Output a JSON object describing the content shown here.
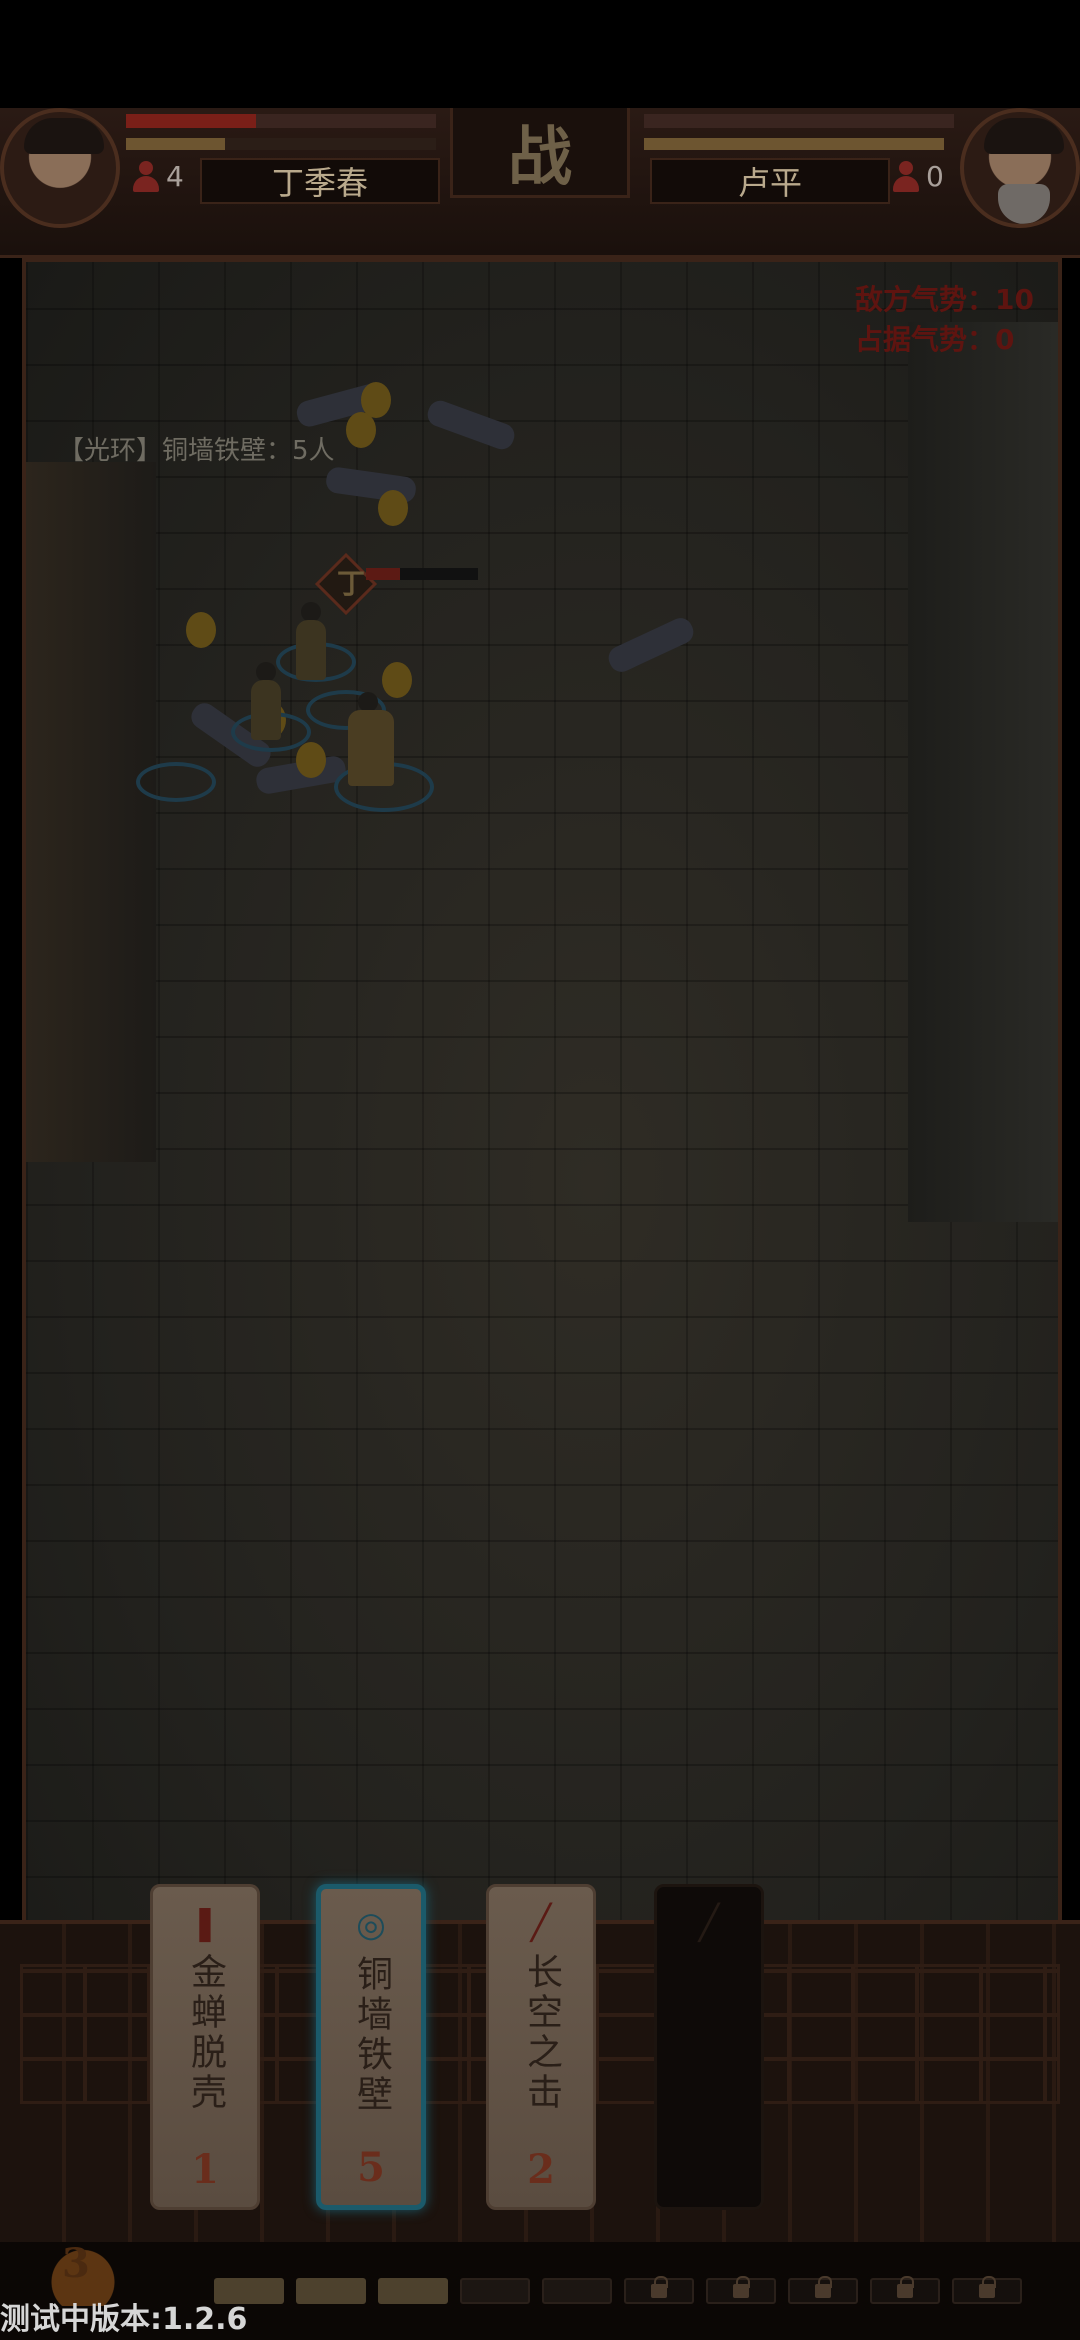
{
  "header": {
    "battle_label": "战",
    "player": {
      "name": "丁季春",
      "units": "4",
      "hp_fraction": 0.42,
      "energy_fraction": 0.32
    },
    "enemy": {
      "name": "卢平",
      "units": "0",
      "hp_fraction": 0.0,
      "energy_fraction": 1.0
    }
  },
  "battlefield": {
    "enemy_morale": "敌方气势：10",
    "own_morale": "占据气势：0",
    "aura_status": "【光环】铜墙铁壁：5人",
    "marker_label": "丁"
  },
  "skill_cards": [
    {
      "icon": "axe-icon",
      "name": "金蝉脱壳",
      "cost": "1",
      "selected": false
    },
    {
      "icon": "target-ring-icon",
      "name": "铜墙铁壁",
      "cost": "5",
      "selected": true
    },
    {
      "icon": "sword-icon",
      "name": "长空之击",
      "cost": "2",
      "selected": false
    },
    {
      "icon": "sword-icon",
      "name": "",
      "cost": "",
      "selected": false,
      "locked": true
    }
  ],
  "resource": {
    "energy_count": "3",
    "slots_filled": 3,
    "slots_empty": 2,
    "slots_locked": 5
  },
  "footer": {
    "version": "测试中版本:1.2.6"
  },
  "colors": {
    "accent_red": "#7a1f18",
    "selected_card": "#1b5a6a",
    "energy": "#6d5530"
  }
}
